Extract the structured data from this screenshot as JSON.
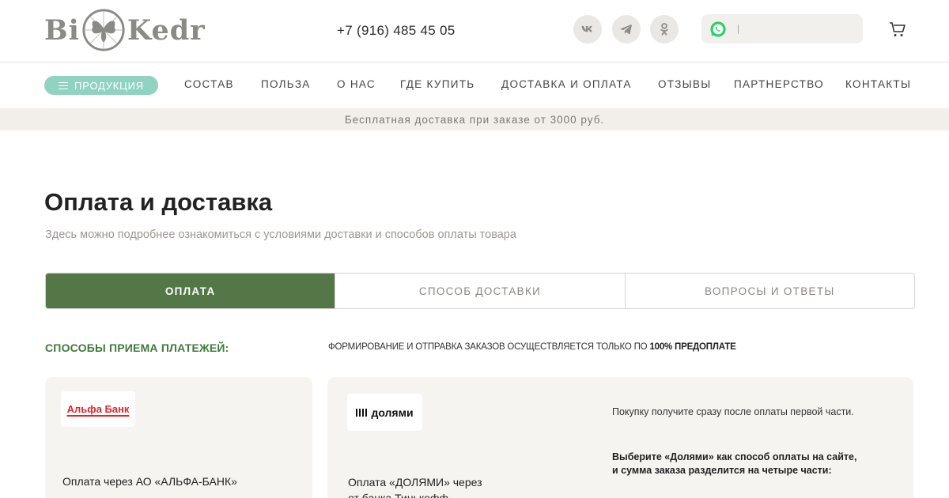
{
  "header": {
    "logo_left": "Bi",
    "logo_right": "Kedr",
    "phone": "+7 (916) 485 45 05",
    "social_icons": [
      "vk-icon",
      "telegram-icon",
      "odnoklassniki-icon"
    ],
    "search": {
      "value": "",
      "placeholder": ""
    },
    "whatsapp_icon": "whatsapp-icon",
    "cart_icon": "cart-icon"
  },
  "nav": {
    "products_label": "ПРОДУКЦИЯ",
    "items": [
      "СОСТАВ",
      "ПОЛЬЗА",
      "О НАС",
      "ГДЕ КУПИТЬ",
      "ДОСТАВКА И ОПЛАТА",
      "ОТЗЫВЫ",
      "ПАРТНЕРСТВО",
      "КОНТАКТЫ"
    ]
  },
  "banner": "Бесплатная доставка при заказе от 3000 руб.",
  "main": {
    "title": "Оплата и доставка",
    "subtitle": "Здесь можно подробнее ознакомиться с условиями доставки и способов оплаты товара",
    "tabs": [
      {
        "label": "ОПЛАТА",
        "active": true
      },
      {
        "label": "СПОСОБ ДОСТАВКИ",
        "active": false
      },
      {
        "label": "ВОПРОСЫ И ОТВЕТЫ",
        "active": false
      }
    ],
    "methods_title": "СПОСОБЫ ПРИЕМА ПЛАТЕЖЕЙ:",
    "prepay_text": "ФОРМИРОВАНИЕ И ОТПРАВКА ЗАКАЗОВ ОСУЩЕСТВЛЯЕТСЯ ТОЛЬКО ПО",
    "prepay_bold": "100% ПРЕДОПЛАТЕ",
    "cards": {
      "alfa": {
        "logo": "Альфа Банк",
        "text": "Оплата через АО «АЛЬФА-БАНК»"
      },
      "dolyami": {
        "logo": "долями",
        "text_line1": "Оплата «ДОЛЯМИ» через",
        "text_line2": "от банка Тинькофф",
        "note": "Покупку получите сразу после оплаты первой части.",
        "bold_line1": "Выберите «Долями» как способ оплаты на сайте,",
        "bold_line2": "и сумма заказа разделится на четыре части:"
      }
    }
  },
  "colors": {
    "accent_green": "#537746",
    "title_green": "#3e7a3a",
    "products_button": "#8fd3c0",
    "banner_bg": "#f2efea",
    "whatsapp": "#25d366",
    "alfa_red": "#e3242b"
  }
}
